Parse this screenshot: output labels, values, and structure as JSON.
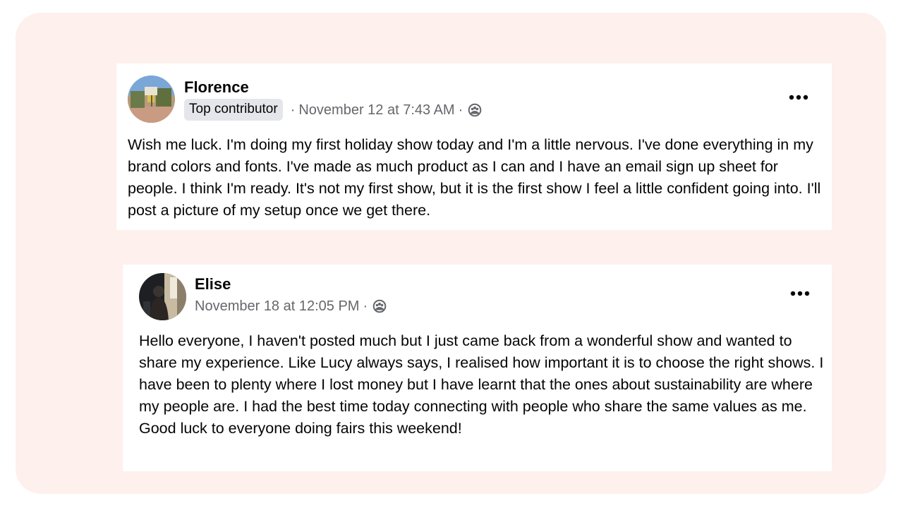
{
  "posts": [
    {
      "author": "Florence",
      "badge": "Top contributor",
      "separator": "·",
      "timestamp": "November 12 at 7:43 AM",
      "audience_icon": "group-icon",
      "more_icon": "more-options-icon",
      "text": "Wish me luck. I'm doing my first holiday show today and I'm a little nervous. I've done everything in my brand colors and fonts. I've made as much product as I can and I have an email sign up sheet for people. I think I'm ready. It's not my first show, but it is the first show I feel a little confident going into. I'll post a picture of my setup once we get there."
    },
    {
      "author": "Elise",
      "separator": "·",
      "timestamp": "November 18 at 12:05 PM",
      "audience_icon": "group-icon",
      "more_icon": "more-options-icon",
      "text": "Hello everyone, I haven't posted much but I just came back from a wonderful show and wanted to share my experience. Like Lucy always says, I realised how important it is to choose the right shows. I have been to plenty where I lost money but I have learnt that the ones about sustainability are where my people are. I had the best time today connecting with people who share the same values as me.\nGood luck to everyone doing fairs this weekend!"
    }
  ],
  "colors": {
    "frame_background": "#fdf0ed",
    "card_background": "#ffffff",
    "primary_text": "#050505",
    "secondary_text": "#65676b",
    "badge_background": "#e4e6eb"
  }
}
